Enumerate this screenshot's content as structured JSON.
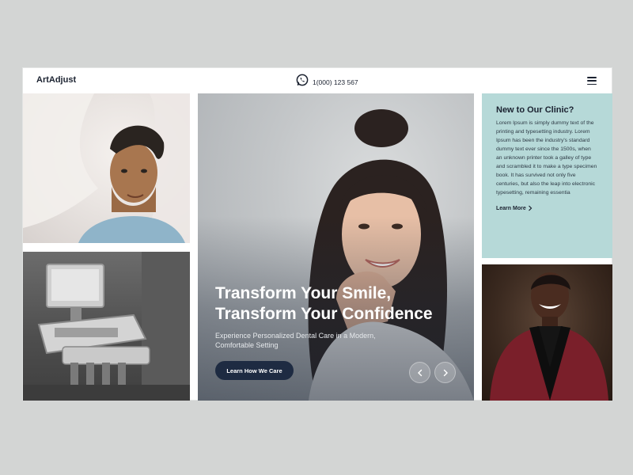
{
  "brand": {
    "logo": "ArtAdjust"
  },
  "header": {
    "phone": "1(000) 123 567",
    "phone_icon": "whatsapp-icon",
    "menu_icon": "hamburger-menu-icon"
  },
  "hero": {
    "title_line1": "Transform Your Smile,",
    "title_line2": "Transform Your Confidence",
    "subtitle": "Experience Personalized Dental Care in a Modern, Comfortable Setting",
    "cta_label": "Learn How We Care",
    "prev_icon": "chevron-left-icon",
    "next_icon": "chevron-right-icon"
  },
  "clinic": {
    "title": "New to Our Clinic?",
    "text": "Lorem Ipsum is simply dummy text of the printing and typesetting industry. Lorem Ipsum has been the industry's standard dummy text ever since the 1500s, when an unknown printer took a galley of type and scrambled it to make a type specimen book. It has survived not only five centuries, but also the leap into electronic typesetting, remaining essentia",
    "link_label": "Learn More",
    "link_icon": "chevron-right-icon"
  },
  "colors": {
    "accent_teal": "#b6d9d8",
    "button_navy": "#1e2b42",
    "text_dark": "#1b2230"
  }
}
